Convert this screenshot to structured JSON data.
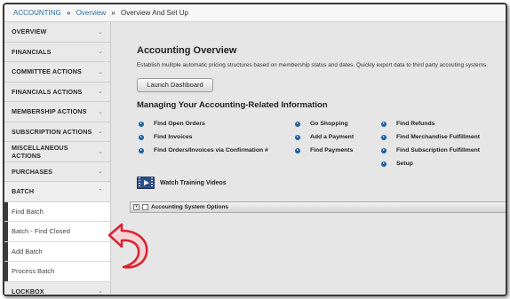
{
  "breadcrumb": {
    "items": [
      "ACCOUNTING",
      "Overview",
      "Overview And Set Up"
    ],
    "separator": "»"
  },
  "sidebar": {
    "items": [
      {
        "label": "OVERVIEW"
      },
      {
        "label": "FINANCIALS"
      },
      {
        "label": "COMMITTEE ACTIONS"
      },
      {
        "label": "FINANCIALS ACTIONS"
      },
      {
        "label": "MEMBERSHIP ACTIONS"
      },
      {
        "label": "SUBSCRIPTION ACTIONS"
      },
      {
        "label": "MISCELLANEOUS ACTIONS"
      },
      {
        "label": "PURCHASES"
      },
      {
        "label": "BATCH"
      }
    ],
    "batch_subitems": [
      "Find Batch",
      "Batch - Find Closed",
      "Add Batch",
      "Process Batch"
    ],
    "after_items": [
      {
        "label": "LOCKBOX"
      }
    ],
    "chevron_collapsed": "⌄",
    "chevron_expanded": "⌃"
  },
  "main": {
    "overview_title": "Accounting Overview",
    "overview_desc": "Establish mulitple automatic pricing structures based on membership status and dates. Quickly export data to third party accouting systems.",
    "launch_button": "Launch Dashboard",
    "managing_title": "Managing Your Accounting-Related Information",
    "link_columns": [
      [
        "Find Open Orders",
        "Find Invoices",
        "Find Orders/Invoices via Confirmation #"
      ],
      [
        "Go Shopping",
        "Add a Payment",
        "Find Payments"
      ],
      [
        "Find Refunds",
        "Find Merchandise Fulfillment",
        "Find Subscription Fulfillment",
        "Setup"
      ]
    ],
    "video_label": "Watch Training Videos",
    "options_label": "Accounting System Options"
  },
  "colors": {
    "link_blue": "#2f6ea8",
    "dot_blue": "#1f5fa0",
    "arrow_red": "#d9202f"
  },
  "icons": [
    "video-icon",
    "chevron-down-icon",
    "chevron-up-icon",
    "arrow-icon",
    "bullet-icon"
  ]
}
